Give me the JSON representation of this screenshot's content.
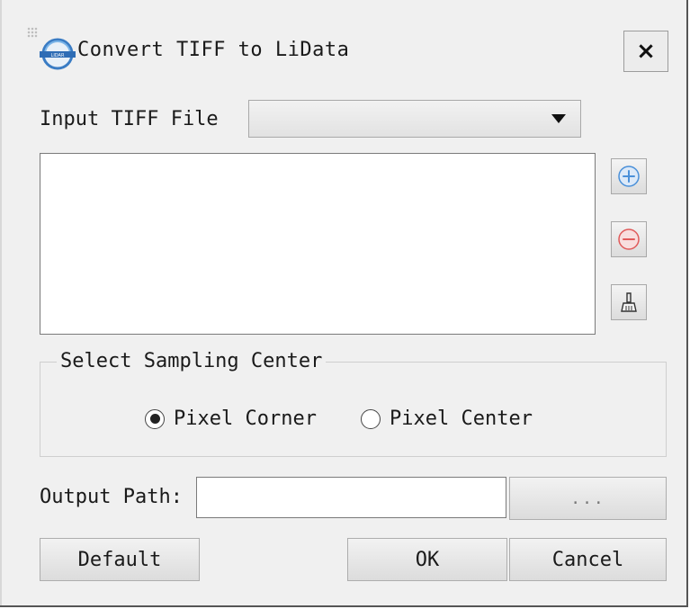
{
  "window": {
    "title": "Convert TIFF to LiData",
    "close_label": "×",
    "logo_icon": "lidata-app-logo-icon"
  },
  "input": {
    "label": "Input TIFF File",
    "selected_value": ""
  },
  "file_list": {
    "items": []
  },
  "side_buttons": {
    "add_icon": "plus-circle-icon",
    "remove_icon": "minus-circle-icon",
    "clear_icon": "broom-icon"
  },
  "sampling": {
    "title": "Select Sampling Center",
    "options": [
      {
        "label": "Pixel Corner",
        "checked": true
      },
      {
        "label": "Pixel Center",
        "checked": false
      }
    ]
  },
  "output": {
    "label": "Output Path:",
    "value": "",
    "browse_label": "..."
  },
  "buttons": {
    "default_label": "Default",
    "ok_label": "OK",
    "cancel_label": "Cancel"
  },
  "colors": {
    "add_icon": "#4a90d9",
    "remove_icon": "#e05a5a",
    "dialog_bg": "#f0f0f0"
  }
}
